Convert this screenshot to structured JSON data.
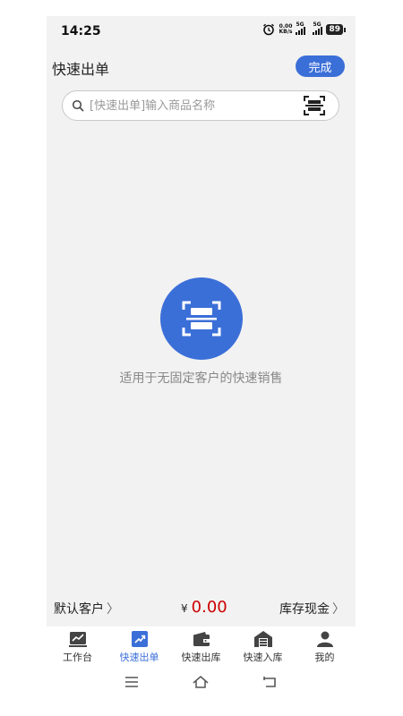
{
  "status_bar": {
    "time": "14:25",
    "net_speed_value": "0.00",
    "net_speed_unit": "KB/s",
    "signal1_label": "5G",
    "signal2_label": "5G",
    "battery": "89"
  },
  "header": {
    "title": "快速出单",
    "done_label": "完成"
  },
  "search": {
    "placeholder": "[快速出单]输入商品名称"
  },
  "empty_state": {
    "hint": "适用于无固定客户的快速销售"
  },
  "summary": {
    "customer_label": "默认客户",
    "currency_symbol": "¥",
    "amount": "0.00",
    "payment_label": "库存现金"
  },
  "tabs": [
    {
      "label": "工作台",
      "icon": "chart-icon"
    },
    {
      "label": "快速出单",
      "icon": "trend-icon"
    },
    {
      "label": "快速出库",
      "icon": "wallet-icon"
    },
    {
      "label": "快速入库",
      "icon": "warehouse-icon"
    },
    {
      "label": "我的",
      "icon": "person-icon"
    }
  ],
  "colors": {
    "accent": "#3b6fd8",
    "amount": "#cc0000",
    "background": "#f2f2f2"
  }
}
